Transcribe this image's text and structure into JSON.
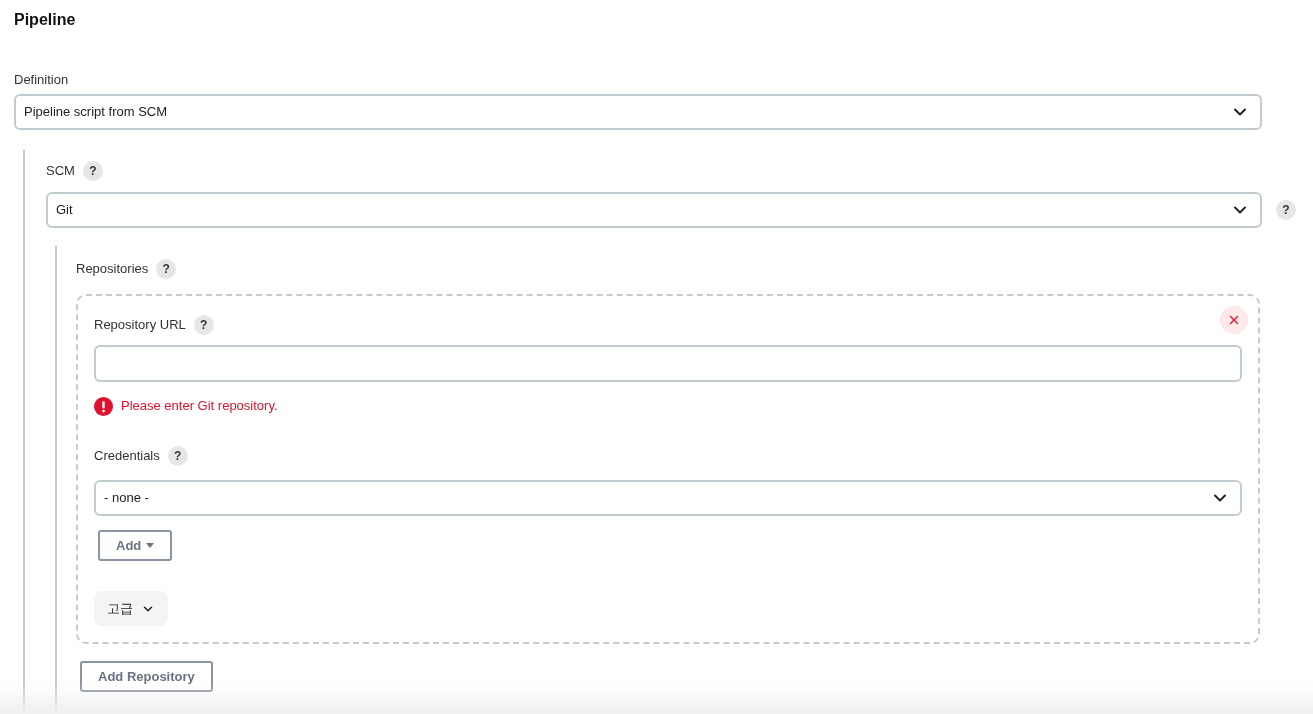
{
  "section_title": "Pipeline",
  "definition": {
    "label": "Definition",
    "value": "Pipeline script from SCM"
  },
  "scm": {
    "label": "SCM",
    "help": "?",
    "value": "Git",
    "side_help": "?"
  },
  "repositories": {
    "label": "Repositories",
    "help": "?",
    "items": [
      {
        "url_label": "Repository URL",
        "url_help": "?",
        "error": "Please enter Git repository.",
        "credentials_label": "Credentials",
        "credentials_help": "?",
        "credentials_value": "- none -",
        "add_button": "Add",
        "advanced_button": "고급"
      }
    ],
    "add_button": "Add Repository"
  }
}
